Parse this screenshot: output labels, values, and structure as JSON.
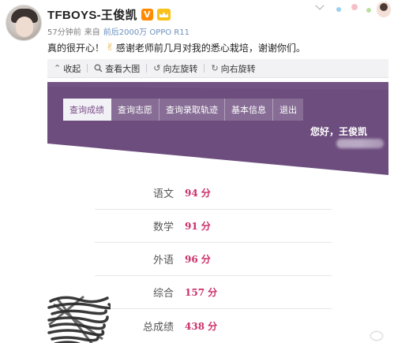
{
  "post": {
    "username": "TFBOYS-王俊凯",
    "verified_badge": "V",
    "member_badge_icon": "crown-icon",
    "time": "57分钟前",
    "source_prefix": "来自",
    "source": "前后2000万 OPPO R11",
    "text_before": "真的很开心！",
    "text_after": "感谢老师前几月对我的悉心栽培，谢谢你们。"
  },
  "toolbar": {
    "collapse": "收起",
    "view_large": "查看大图",
    "rotate_left": "向左旋转",
    "rotate_right": "向右旋转"
  },
  "portal": {
    "tabs": [
      "查询成绩",
      "查询志愿",
      "查询录取轨迹",
      "基本信息",
      "退出"
    ],
    "active_tab": 0,
    "greeting": "您好，王俊凯",
    "colors": {
      "banner": "#6d4d7e",
      "accent": "#cc2e6a"
    }
  },
  "scores": [
    {
      "subject": "语文",
      "value": "94",
      "unit": "分"
    },
    {
      "subject": "数学",
      "value": "91",
      "unit": "分"
    },
    {
      "subject": "外语",
      "value": "96",
      "unit": "分"
    },
    {
      "subject": "综合",
      "value": "157",
      "unit": "分"
    },
    {
      "subject": "总成绩",
      "value": "438",
      "unit": "分"
    }
  ]
}
